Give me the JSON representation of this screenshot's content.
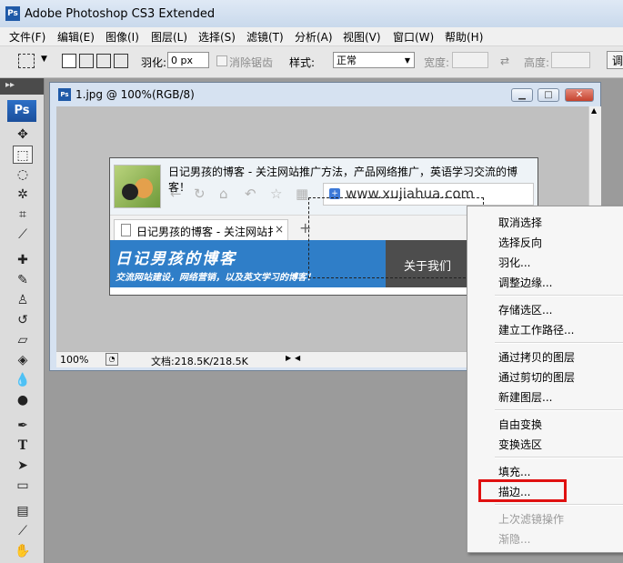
{
  "app": {
    "logo": "Ps",
    "title": "Adobe Photoshop CS3 Extended"
  },
  "menu": [
    "文件(F)",
    "编辑(E)",
    "图像(I)",
    "图层(L)",
    "选择(S)",
    "滤镜(T)",
    "分析(A)",
    "视图(V)",
    "窗口(W)",
    "帮助(H)"
  ],
  "options": {
    "feather_label": "羽化:",
    "feather_value": "0 px",
    "antialias_label": "消除锯齿",
    "style_label": "样式:",
    "style_value": "正常",
    "width_label": "宽度:",
    "height_label": "高度:",
    "refine_label": "调"
  },
  "toolbox": {
    "logo": "Ps"
  },
  "document": {
    "title": "1.jpg @ 100%(RGB/8)",
    "zoom": "100%",
    "doc_info": "文档:218.5K/218.5K"
  },
  "image": {
    "heading": "日记男孩的博客 - 关注网站推广方法，产品网络推广，英语学习交流的博客！",
    "url": "www.xujiahua.com",
    "tab_title": "日记男孩的博客 - 关注网站扌",
    "tab_close": "×",
    "tab_new": "+",
    "banner_title": "日记男孩的博客",
    "banner_subtitle": "交流网站建设，网络营销，以及英文学习的博客！",
    "about": "关于我们"
  },
  "context_menu": {
    "groups": [
      [
        "取消选择",
        "选择反向",
        "羽化...",
        "调整边缘..."
      ],
      [
        "存储选区...",
        "建立工作路径..."
      ],
      [
        "通过拷贝的图层",
        "通过剪切的图层",
        "新建图层..."
      ],
      [
        "自由变换",
        "变换选区"
      ],
      [
        "填充...",
        "描边..."
      ],
      [
        "上次滤镜操作",
        "渐隐..."
      ]
    ],
    "highlight_color": "#e01010"
  }
}
